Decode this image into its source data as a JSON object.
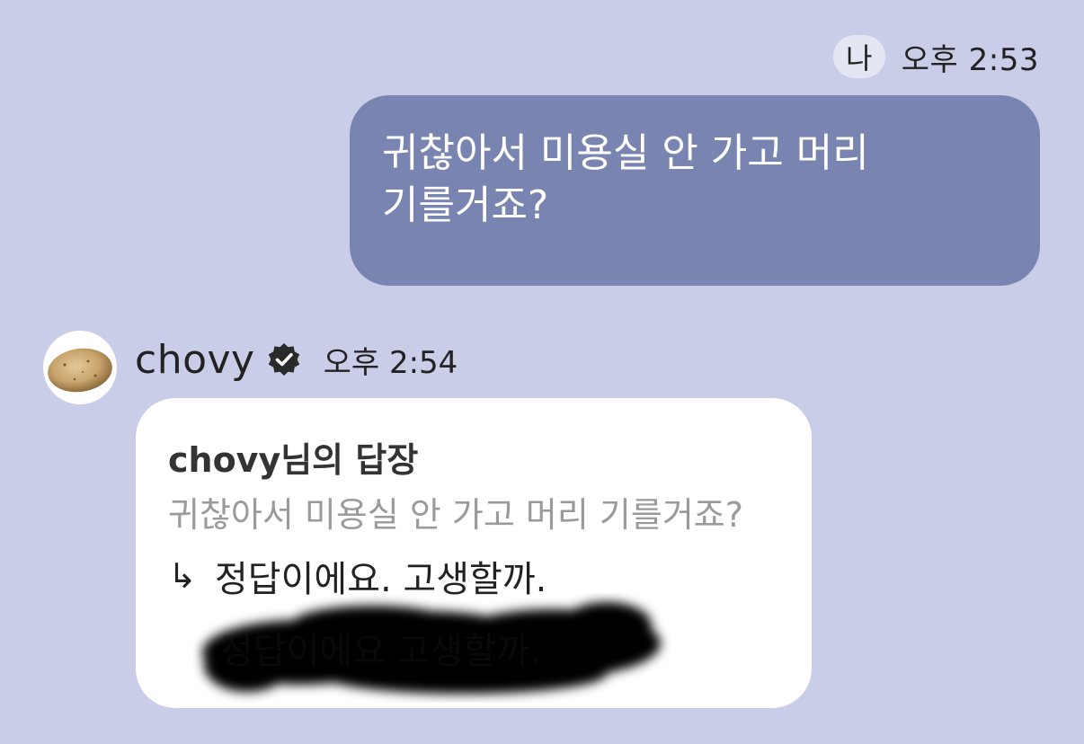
{
  "outgoing": {
    "sender_badge": "나",
    "time": "오후 2:53",
    "text": "귀찮아서 미용실 안 가고 머리 기를거죠?"
  },
  "incoming": {
    "avatar_icon": "potato-avatar-icon",
    "sender": "chovy",
    "verified_icon": "verified-badge-icon",
    "time": "오후 2:54",
    "reply_title": "chovy님의 답장",
    "reply_quote": "귀찮아서 미용실 안 가고 머리 기를거죠?",
    "reply_arrow": "↳",
    "reply_text": "정답이에요. 고생할까."
  },
  "colors": {
    "background": "#c9cde8",
    "outgoing_bubble": "#7a84b0",
    "incoming_bubble": "#ffffff"
  }
}
